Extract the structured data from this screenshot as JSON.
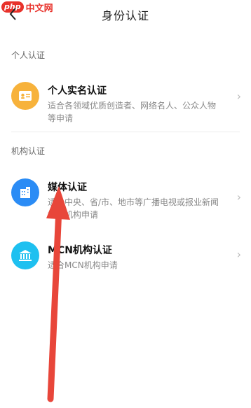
{
  "watermark": {
    "badge": "php",
    "text": "中文网"
  },
  "header": {
    "title": "身份认证",
    "back_icon": "chevron-left-icon"
  },
  "sections": {
    "personal": {
      "label": "个人认证"
    },
    "org": {
      "label": "机构认证"
    }
  },
  "items": {
    "personal": {
      "title": "个人实名认证",
      "desc": "适合各领域优质创造者、网络名人、公众人物等申请",
      "icon": "id-card-icon",
      "color": "#f7b23b"
    },
    "media": {
      "title": "媒体认证",
      "desc": "适合中央、省/市、地市等广播电视或报业新闻媒体机构申请",
      "icon": "building-icon",
      "color": "#2b8cf5"
    },
    "mcn": {
      "title": "MCN机构认证",
      "desc": "适合MCN机构申请",
      "icon": "institution-icon",
      "color": "#1ec0f0"
    }
  },
  "annotation": {
    "color": "#e8463a"
  }
}
